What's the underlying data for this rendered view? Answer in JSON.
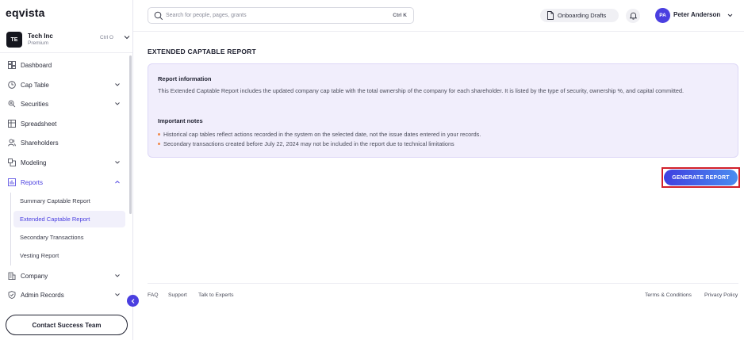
{
  "app": {
    "logo": "eqvista"
  },
  "company": {
    "initials": "TE",
    "name": "Tech Inc",
    "plan": "Premium",
    "shortcut": "Ctrl O"
  },
  "sidebar": {
    "items": [
      {
        "label": "Dashboard",
        "icon": "dashboard-icon",
        "has_chevron": false
      },
      {
        "label": "Cap Table",
        "icon": "pie-clock-icon",
        "has_chevron": true
      },
      {
        "label": "Securities",
        "icon": "securities-icon",
        "has_chevron": true
      },
      {
        "label": "Spreadsheet",
        "icon": "spreadsheet-icon",
        "has_chevron": false
      },
      {
        "label": "Shareholders",
        "icon": "users-icon",
        "has_chevron": false
      },
      {
        "label": "Modeling",
        "icon": "modeling-icon",
        "has_chevron": true
      },
      {
        "label": "Reports",
        "icon": "reports-icon",
        "has_chevron": true,
        "expanded": true
      },
      {
        "label": "Company",
        "icon": "company-icon",
        "has_chevron": true
      },
      {
        "label": "Admin Records",
        "icon": "shield-icon",
        "has_chevron": true
      }
    ],
    "report_subitems": [
      {
        "label": "Summary Captable Report"
      },
      {
        "label": "Extended Captable Report",
        "active": true
      },
      {
        "label": "Secondary Transactions"
      },
      {
        "label": "Vesting Report"
      }
    ],
    "contact_button": "Contact Success Team"
  },
  "header": {
    "search_placeholder": "Search for people, pages, grants",
    "search_shortcut": "Ctrl K",
    "drafts_button": "Onboarding Drafts",
    "user_initials": "PA",
    "user_name": "Peter Anderson"
  },
  "main": {
    "title": "EXTENDED CAPTABLE REPORT",
    "info_heading": "Report information",
    "info_text": "This Extended Captable Report includes the updated company cap table with the total ownership of the company for each shareholder. It is listed by the type of security, ownership %, and capital committed.",
    "notes_heading": "Important notes",
    "notes": [
      "Historical cap tables reflect actions recorded in the system on the selected date, not the issue dates entered in your records.",
      "Secondary transactions created before July 22, 2024 may not be included in the report due to technical limitations"
    ],
    "generate_button": "GENERATE REPORT"
  },
  "footer": {
    "left_links": [
      "FAQ",
      "Support",
      "Talk to Experts"
    ],
    "right_links": [
      "Terms & Conditions",
      "Privacy Policy"
    ]
  },
  "colors": {
    "accent": "#4a3fe0",
    "highlight_outline": "#d11f2a",
    "info_bg": "#f1eefc"
  }
}
